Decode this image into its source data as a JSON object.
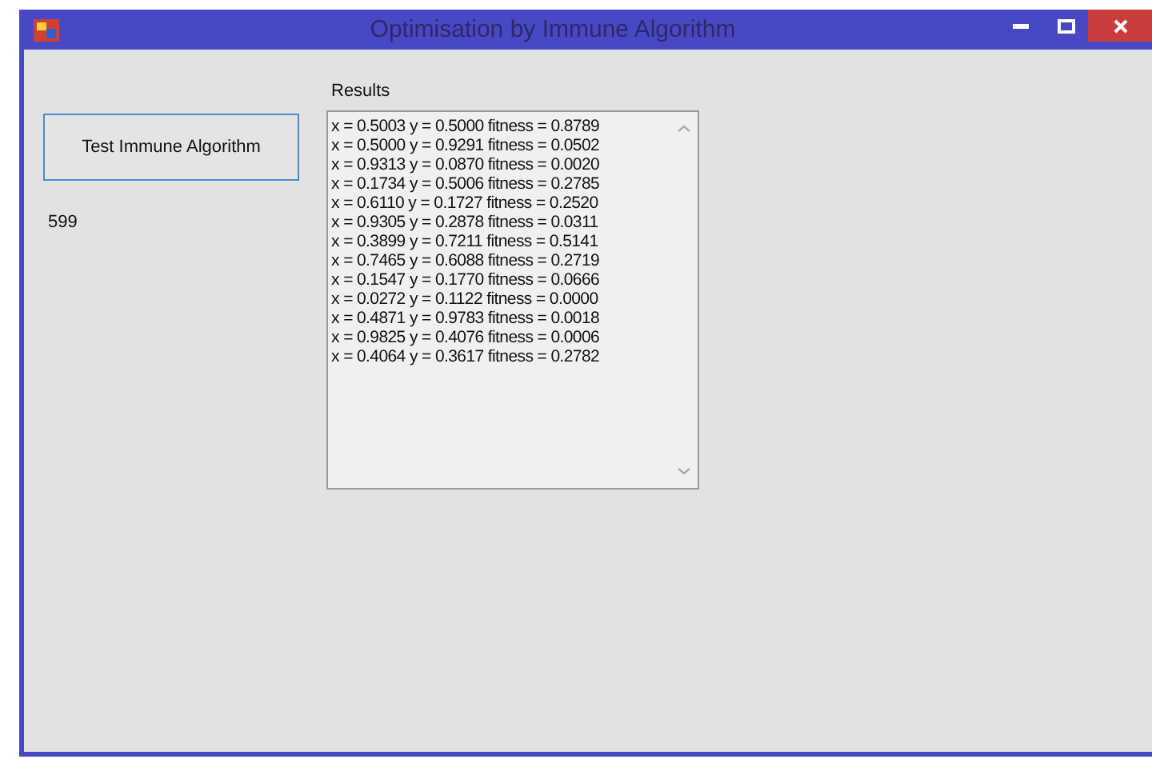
{
  "window": {
    "title": "Optimisation by Immune Algorithm"
  },
  "button": {
    "label": "Test Immune Algorithm"
  },
  "count_label": "599",
  "results": {
    "label": "Results",
    "lines": [
      "x = 0.5003 y = 0.5000 fitness = 0.8789",
      "x = 0.5000 y = 0.9291 fitness = 0.0502",
      "x = 0.9313 y = 0.0870 fitness = 0.0020",
      "x = 0.1734 y = 0.5006 fitness = 0.2785",
      "x = 0.6110 y = 0.1727 fitness = 0.2520",
      "x = 0.9305 y = 0.2878 fitness = 0.0311",
      "x = 0.3899 y = 0.7211 fitness = 0.5141",
      "x = 0.7465 y = 0.6088 fitness = 0.2719",
      "x = 0.1547 y = 0.1770 fitness = 0.0666",
      "x = 0.0272 y = 0.1122 fitness = 0.0000",
      "x = 0.4871 y = 0.9783 fitness = 0.0018",
      "x = 0.9825 y = 0.4076 fitness = 0.0006",
      "x = 0.4064 y = 0.3617 fitness = 0.2782"
    ]
  }
}
